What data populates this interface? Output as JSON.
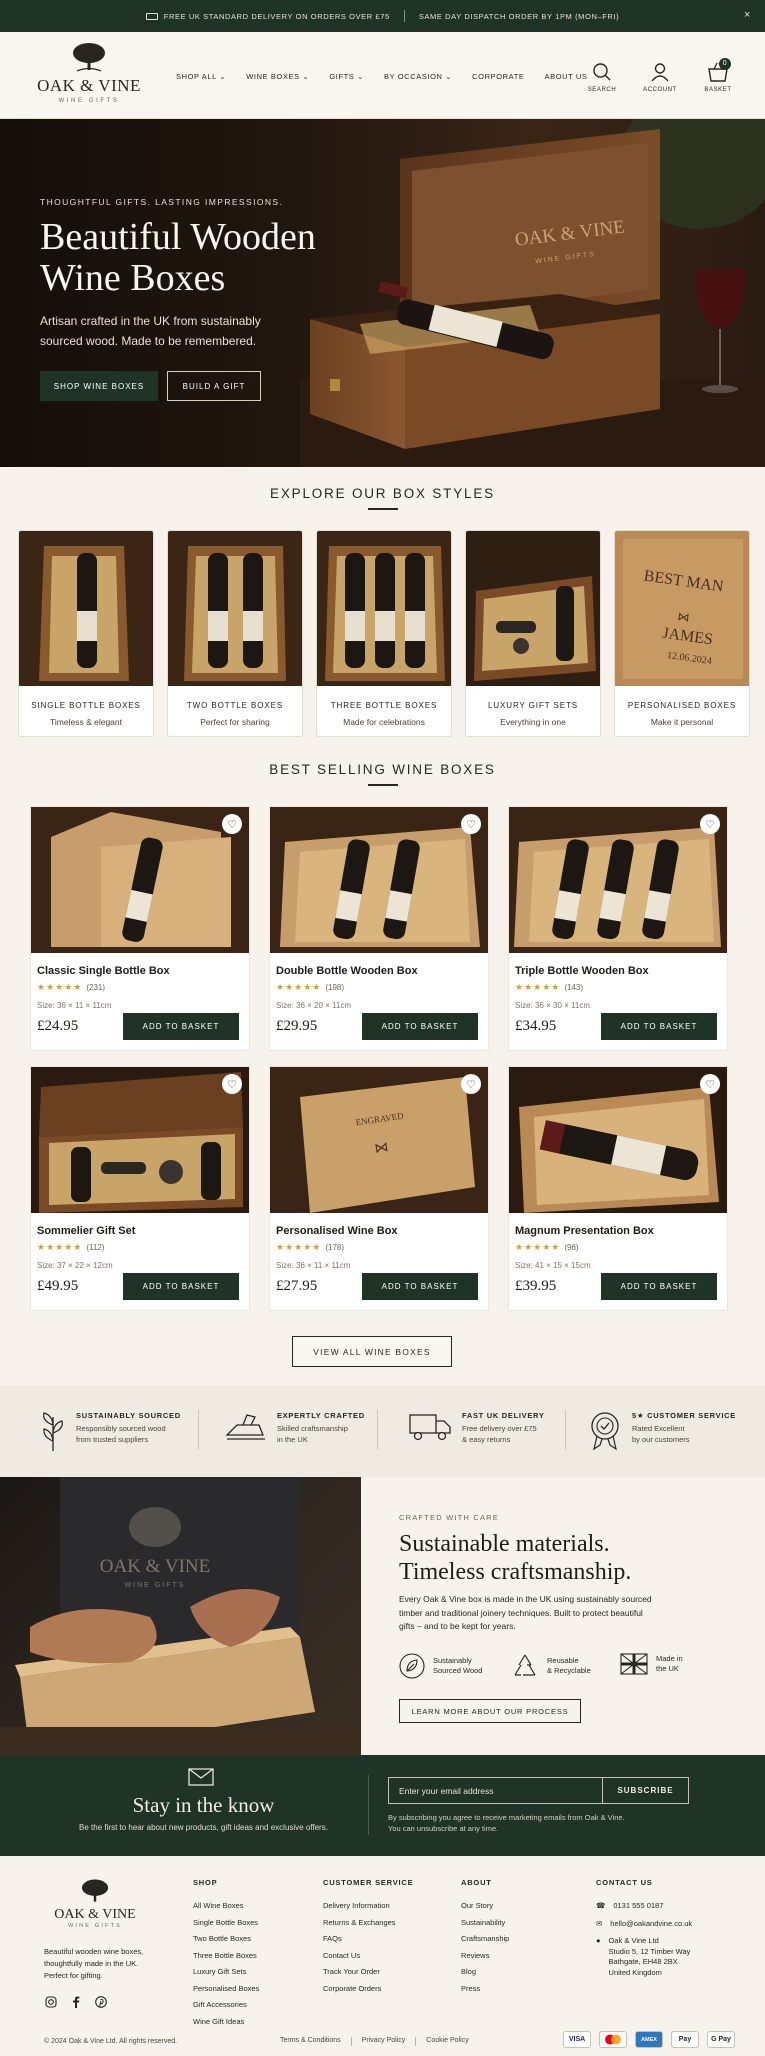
{
  "topbar": {
    "left_text": "FREE UK STANDARD DELIVERY ON ORDERS OVER £75",
    "right_text": "SAME DAY DISPATCH ORDER BY 1PM (MON–FRI)",
    "close_symbol": "×"
  },
  "brand": {
    "name": "OAK & VINE",
    "tagline": "WINE GIFTS"
  },
  "nav": [
    "SHOP ALL",
    "WINE BOXES",
    "GIFTS",
    "BY OCCASION",
    "CORPORATE",
    "ABOUT US"
  ],
  "nav_dropdown": [
    true,
    true,
    true,
    true,
    false,
    false
  ],
  "header_icons": {
    "search": "SEARCH",
    "account": "ACCOUNT",
    "basket": "BASKET",
    "basket_count": "0"
  },
  "hero": {
    "kicker": "THOUGHTFUL GIFTS. LASTING IMPRESSIONS.",
    "title": "Beautiful Wooden Wine Boxes",
    "description": "Artisan crafted in the UK from sustainably sourced wood. Made to be remembered.",
    "primary_cta": "SHOP WINE BOXES",
    "secondary_cta": "BUILD A GIFT",
    "box_lid_text": "OAK & VINE",
    "box_lid_sub": "WINE GIFTS"
  },
  "styles_section": {
    "title": "EXPLORE OUR BOX STYLES",
    "cards": [
      {
        "title": "SINGLE BOTTLE BOXES",
        "subtitle": "Timeless & elegant"
      },
      {
        "title": "TWO BOTTLE BOXES",
        "subtitle": "Perfect for sharing"
      },
      {
        "title": "THREE BOTTLE BOXES",
        "subtitle": "Made for celebrations"
      },
      {
        "title": "LUXURY GIFT SETS",
        "subtitle": "Everything in one"
      },
      {
        "title": "PERSONALISED BOXES",
        "subtitle": "Make it personal"
      }
    ],
    "engraving": [
      "BEST MAN",
      "JAMES",
      "12.06.2024"
    ]
  },
  "bestsellers": {
    "title": "BEST SELLING WINE BOXES",
    "add_label": "ADD TO BASKET",
    "products": [
      {
        "name": "Classic Single Bottle Box",
        "stars": "★★★★★",
        "reviews": "(231)",
        "size": "Size: 36 × 11 × 11cm",
        "price": "£24.95"
      },
      {
        "name": "Double Bottle Wooden Box",
        "stars": "★★★★★",
        "reviews": "(198)",
        "size": "Size: 36 × 20 × 11cm",
        "price": "£29.95"
      },
      {
        "name": "Triple Bottle Wooden Box",
        "stars": "★★★★★",
        "reviews": "(143)",
        "size": "Size: 36 × 30 × 11cm",
        "price": "£34.95"
      },
      {
        "name": "Sommelier Gift Set",
        "stars": "★★★★★",
        "reviews": "(112)",
        "size": "Size: 37 × 22 × 12cm",
        "price": "£49.95"
      },
      {
        "name": "Personalised Wine Box",
        "stars": "★★★★★",
        "reviews": "(178)",
        "size": "Size: 36 × 11 × 11cm",
        "price": "£27.95"
      },
      {
        "name": "Magnum Presentation Box",
        "stars": "★★★★★",
        "reviews": "(96)",
        "size": "Size: 41 × 15 × 15cm",
        "price": "£39.95"
      }
    ],
    "view_all": "VIEW ALL WINE BOXES"
  },
  "features": [
    {
      "title": "SUSTAINABLY SOURCED",
      "line1": "Responsibly sourced wood",
      "line2": "from trusted suppliers",
      "icon": "leaf-icon"
    },
    {
      "title": "EXPERTLY CRAFTED",
      "line1": "Skilled craftsmanship",
      "line2": "in the UK",
      "icon": "plane-tool-icon"
    },
    {
      "title": "FAST UK DELIVERY",
      "line1": "Free delivery over £75",
      "line2": "& easy returns",
      "icon": "truck-icon"
    },
    {
      "title": "5★ CUSTOMER SERVICE",
      "line1": "Rated Excellent",
      "line2": "by our customers",
      "icon": "award-icon"
    }
  ],
  "craft": {
    "kicker": "CRAFTED WITH CARE",
    "title_line1": "Sustainable materials.",
    "title_line2": "Timeless craftsmanship.",
    "body": "Every Oak & Vine box is made in the UK using sustainably sourced timber and traditional joinery techniques. Built to protect beautiful gifts – and to be kept for years.",
    "apron_brand": "OAK & VINE",
    "apron_sub": "WINE GIFTS",
    "badges": [
      {
        "l1": "Sustainably",
        "l2": "Sourced Wood"
      },
      {
        "l1": "Reusable",
        "l2": "& Recyclable"
      },
      {
        "l1": "Made in",
        "l2": "the UK"
      }
    ],
    "cta": "LEARN MORE ABOUT OUR PROCESS"
  },
  "newsletter": {
    "title": "Stay in the know",
    "description": "Be the first to hear about new products, gift ideas and exclusive offers.",
    "placeholder": "Enter your email address",
    "button": "SUBSCRIBE",
    "fine_line1": "By subscribing you agree to receive marketing emails from Oak & Vine.",
    "fine_line2": "You can unsubscribe at any time."
  },
  "footer": {
    "tagline": "Beautiful wooden wine boxes, thoughtfully made in the UK. Perfect for gifting.",
    "shop": {
      "heading": "SHOP",
      "links": [
        "All Wine Boxes",
        "Single Bottle Boxes",
        "Two Bottle Boxes",
        "Three Bottle Boxes",
        "Luxury Gift Sets",
        "Personalised Boxes",
        "Gift Accessories",
        "Wine Gift Ideas"
      ]
    },
    "service": {
      "heading": "CUSTOMER SERVICE",
      "links": [
        "Delivery Information",
        "Returns & Exchanges",
        "FAQs",
        "Contact Us",
        "Track Your Order",
        "Corporate Orders"
      ]
    },
    "about": {
      "heading": "ABOUT",
      "links": [
        "Our Story",
        "Sustainability",
        "Craftsmanship",
        "Reviews",
        "Blog",
        "Press"
      ]
    },
    "contact": {
      "heading": "CONTACT US",
      "phone": "0131 555 0187",
      "email": "hello@oakandvine.co.uk",
      "address": [
        "Oak & Vine Ltd",
        "Studio 5, 12 Timber Way",
        "Bathgate, EH48 2BX",
        "United Kingdom"
      ]
    },
    "copyright": "© 2024 Oak & Vine Ltd. All rights reserved.",
    "legal": [
      "Terms & Conditions",
      "Privacy Policy",
      "Cookie Policy"
    ],
    "payments": [
      "VISA",
      "MC",
      "AMEX",
      "Pay",
      "G Pay"
    ]
  }
}
